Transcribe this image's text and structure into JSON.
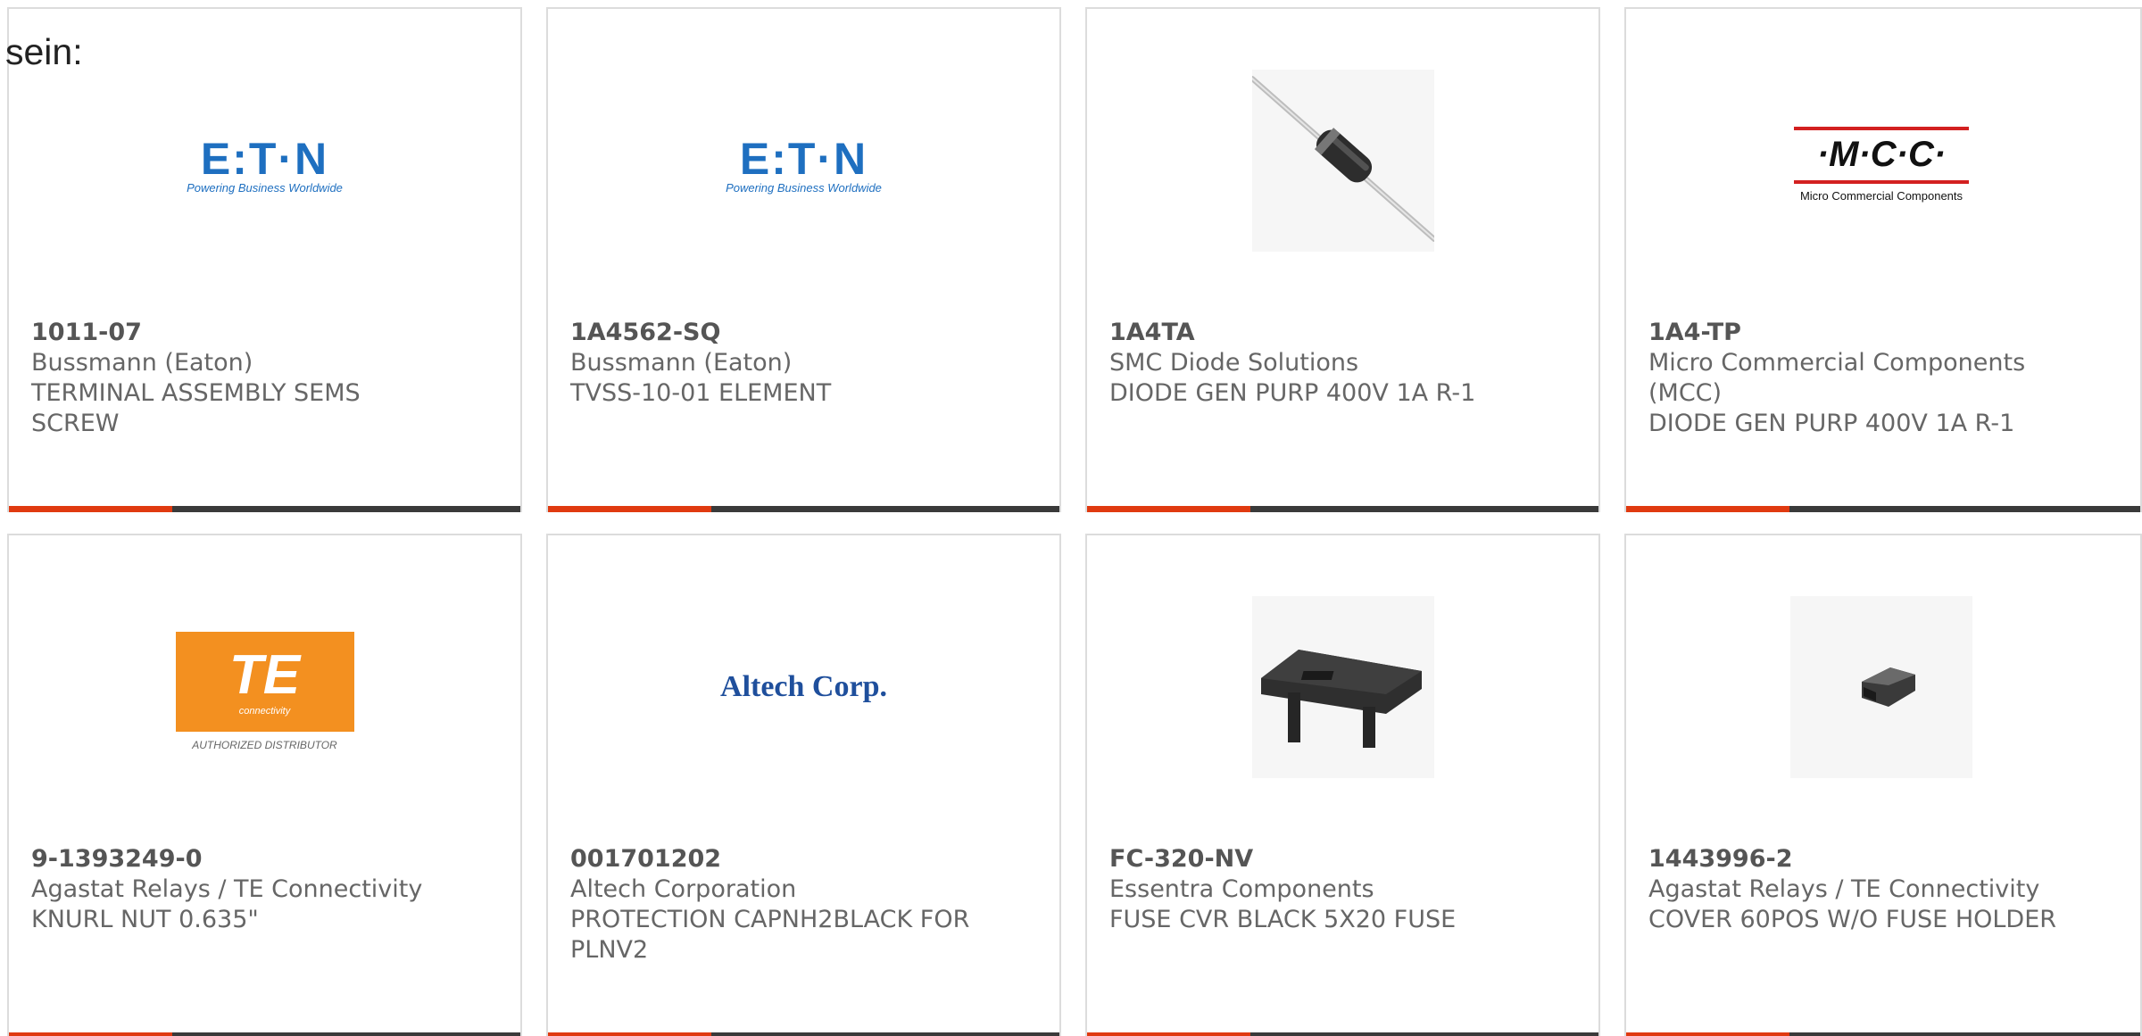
{
  "intro": "sein:",
  "colors": {
    "accent": "#e03a10",
    "bar": "#3a3a3a",
    "card_border": "#dcdcdc"
  },
  "products": [
    {
      "part_number": "1011-07",
      "manufacturer": "Bussmann (Eaton)",
      "description": "TERMINAL ASSEMBLY SEMS SCREW",
      "image": {
        "kind": "logo",
        "icon": "eaton-logo",
        "text": "E:T·N",
        "tagline": "Powering Business Worldwide"
      }
    },
    {
      "part_number": "1A4562-SQ",
      "manufacturer": "Bussmann (Eaton)",
      "description": "TVSS-10-01 ELEMENT",
      "image": {
        "kind": "logo",
        "icon": "eaton-logo",
        "text": "E:T·N",
        "tagline": "Powering Business Worldwide"
      }
    },
    {
      "part_number": "1A4TA",
      "manufacturer": "SMC Diode Solutions",
      "description": "DIODE GEN PURP 400V 1A R-1",
      "image": {
        "kind": "photo",
        "icon": "axial-diode-photo"
      }
    },
    {
      "part_number": "1A4-TP",
      "manufacturer": "Micro Commercial Components (MCC)",
      "description": "DIODE GEN PURP 400V 1A R-1",
      "image": {
        "kind": "logo",
        "icon": "mcc-logo",
        "text": "·M·C·C·",
        "tagline": "Micro Commercial Components"
      }
    },
    {
      "part_number": "9-1393249-0",
      "manufacturer": "Agastat Relays / TE Connectivity",
      "description": "KNURL NUT 0.635\"",
      "image": {
        "kind": "logo",
        "icon": "te-logo",
        "text": "TE",
        "tagline": "connectivity",
        "note": "AUTHORIZED DISTRIBUTOR"
      }
    },
    {
      "part_number": "001701202",
      "manufacturer": "Altech Corporation",
      "description": "PROTECTION CAPNH2BLACK FOR PLNV2",
      "image": {
        "kind": "logo",
        "icon": "altech-logo",
        "text": "Altech Corp."
      }
    },
    {
      "part_number": "FC-320-NV",
      "manufacturer": "Essentra Components",
      "description": "FUSE CVR BLACK 5X20 FUSE",
      "image": {
        "kind": "photo",
        "icon": "fuse-cover-photo"
      }
    },
    {
      "part_number": "1443996-2",
      "manufacturer": "Agastat Relays / TE Connectivity",
      "description": "COVER 60POS W/O FUSE HOLDER",
      "image": {
        "kind": "photo",
        "icon": "connector-cover-photo"
      }
    }
  ]
}
